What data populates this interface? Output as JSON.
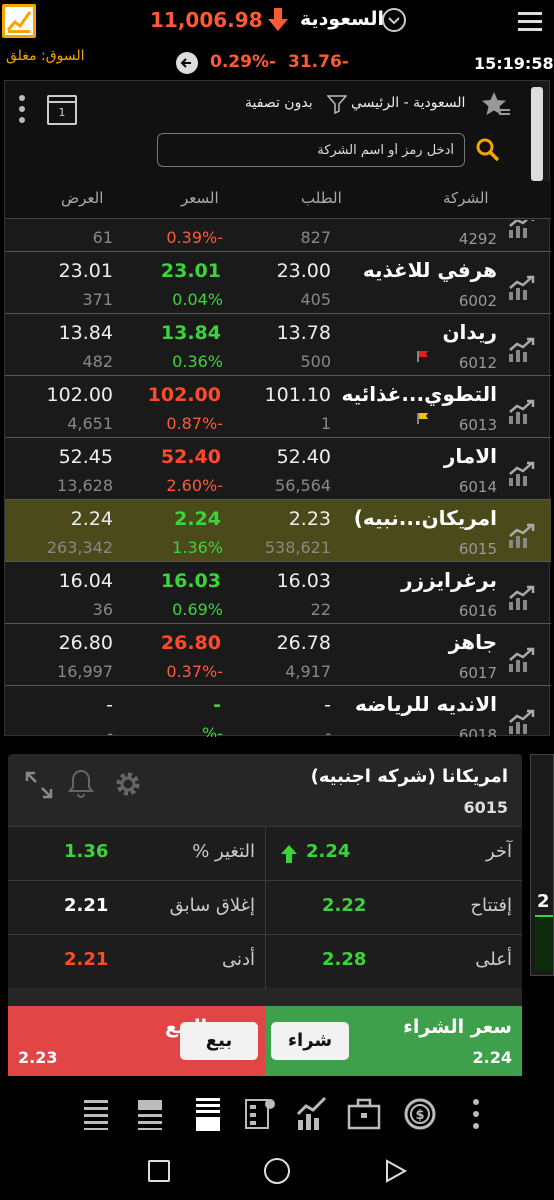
{
  "top": {
    "market_name": "السعودية",
    "index_value": "11,006.98",
    "market_status": "السوق: مغلق",
    "change_pct": "0.29%-",
    "change_val": "31.76-",
    "clock": "15:19:58"
  },
  "panel": {
    "list_name": "السعودية - الرئيسي",
    "filter_label": "بدون تصفية",
    "calendar_day": "1",
    "search_placeholder": "أدخل رمز أو اسم الشركة",
    "columns": {
      "company": "الشركة",
      "bid": "الطلب",
      "price": "السعر",
      "ask": "العرض"
    }
  },
  "rows": [
    {
      "name": "",
      "symbol": "4292",
      "bid": "",
      "price": "",
      "ask": "",
      "bid_qty": "827",
      "pct": "0.39%-",
      "ask_qty": "61",
      "dir": "down",
      "flag": ""
    },
    {
      "name": "هرفي للاغذيه",
      "symbol": "6002",
      "bid": "23.00",
      "price": "23.01",
      "ask": "23.01",
      "bid_qty": "405",
      "pct": "0.04%",
      "ask_qty": "371",
      "dir": "up",
      "flag": ""
    },
    {
      "name": "ريدان",
      "symbol": "6012",
      "bid": "13.78",
      "price": "13.84",
      "ask": "13.84",
      "bid_qty": "500",
      "pct": "0.36%",
      "ask_qty": "482",
      "dir": "up",
      "flag": "#e02020"
    },
    {
      "name": "التطوي...غذائيه",
      "symbol": "6013",
      "bid": "101.10",
      "price": "102.00",
      "ask": "102.00",
      "bid_qty": "1",
      "pct": "0.87%-",
      "ask_qty": "4,651",
      "dir": "down",
      "flag": "#f5c400"
    },
    {
      "name": "الامار",
      "symbol": "6014",
      "bid": "52.40",
      "price": "52.40",
      "ask": "52.45",
      "bid_qty": "56,564",
      "pct": "2.60%-",
      "ask_qty": "13,628",
      "dir": "down",
      "flag": ""
    },
    {
      "name": "امريكان...نبيه)",
      "symbol": "6015",
      "bid": "2.23",
      "price": "2.24",
      "ask": "2.24",
      "bid_qty": "538,621",
      "pct": "1.36%",
      "ask_qty": "263,342",
      "dir": "up",
      "flag": "",
      "highlight": true
    },
    {
      "name": "برغرايززر",
      "symbol": "6016",
      "bid": "16.03",
      "price": "16.03",
      "ask": "16.04",
      "bid_qty": "22",
      "pct": "0.69%",
      "ask_qty": "36",
      "dir": "up",
      "flag": ""
    },
    {
      "name": "جاهز",
      "symbol": "6017",
      "bid": "26.78",
      "price": "26.80",
      "ask": "26.80",
      "bid_qty": "4,917",
      "pct": "0.37%-",
      "ask_qty": "16,997",
      "dir": "down",
      "flag": ""
    },
    {
      "name": "الانديه للرياضه",
      "symbol": "6018",
      "bid": "-",
      "price": "-",
      "ask": "-",
      "bid_qty": "-",
      "pct": "%-",
      "ask_qty": "-",
      "dir": "up",
      "flag": ""
    }
  ],
  "detail": {
    "name": "امريكانا (شركه اجنبيه)",
    "symbol": "6015",
    "last_label": "آخر",
    "last_val": "2.24",
    "change_label": "التغير %",
    "change_val": "1.36",
    "open_label": "إفتتاح",
    "open_val": "2.22",
    "prev_close_label": "إغلاق سابق",
    "prev_close_val": "2.21",
    "high_label": "أعلى",
    "high_val": "2.28",
    "low_label": "أدنى",
    "low_val": "2.21",
    "buy_label": "سعر الشراء",
    "buy_price": "2.24",
    "buy_btn": "شراء",
    "sell_label": "سعر البيع",
    "sell_price": "2.23",
    "sell_btn": "بيع"
  },
  "side_tab": {
    "value": "2"
  },
  "colors": {
    "up": "#3bd43b",
    "down": "#ff4a2a",
    "accent": "#f5a400",
    "buy": "#3ea04a",
    "sell": "#e24545"
  },
  "bottom_nav": [
    "list-icon",
    "compact-list-icon",
    "detail-list-icon",
    "settings-grid-icon",
    "chart-trend-icon",
    "portfolio-briefcase-icon",
    "money-cycle-icon",
    "more-vertical-icon"
  ]
}
